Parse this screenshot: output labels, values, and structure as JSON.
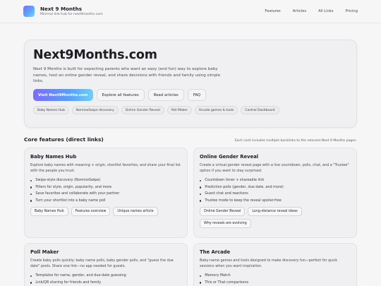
{
  "header": {
    "title": "Next 9 Months",
    "subtitle": "Minimal link hub for next9months.com",
    "nav": [
      "Features",
      "Articles",
      "All Links",
      "Pricing"
    ]
  },
  "hero": {
    "title": "Next9Months.com",
    "description": "Next 9 Months is built for expecting parents who want an easy (and fun) way to explore baby names, host an online gender reveal, and share decisions with friends and family using simple links.",
    "ctas": [
      "Visit Next9Months.com",
      "Explore all features",
      "Read articles",
      "FAQ"
    ],
    "chips": [
      "Baby Names Hub",
      "NominoSwipe discovery",
      "Online Gender Reveal",
      "Poll Maker",
      "Arcade games & tools",
      "Central Dashboard"
    ]
  },
  "section": {
    "title": "Core features (direct links)",
    "note": "Each card includes multiple backlinks to the relevant Next 9 Months pages."
  },
  "cards": [
    {
      "title": "Baby Names Hub",
      "description": "Explore baby names with meaning + origin, shortlist favorites, and share your final list with the people you trust.",
      "bullets": [
        "Swipe-style discovery (NominoSwipe)",
        "Filters for style, origin, popularity, and more",
        "Save favorites and collaborate with your partner",
        "Turn your shortlist into a baby name poll"
      ],
      "links": [
        "Baby Names Hub",
        "Features overview",
        "Unique names article"
      ]
    },
    {
      "title": "Online Gender Reveal",
      "description": "Create a virtual gender reveal page with a live countdown, polls, chat, and a \"Trustee\" option if you want to stay surprised.",
      "bullets": [
        "Countdown timer + shareable link",
        "Prediction polls (gender, due date, and more)",
        "Guest chat and reactions",
        "Trustee mode to keep the reveal spoiler-free"
      ],
      "links": [
        "Online Gender Reveal",
        "Long-distance reveal ideas",
        "Why reveals are evolving"
      ]
    },
    {
      "title": "Poll Maker",
      "description": "Create baby polls quickly: baby name polls, baby gender polls, and \"guess the due date\" pools. Share one link—no app needed for guests.",
      "bullets": [
        "Templates for name, gender, and due-date guessing",
        "Link/QR sharing for friends and family"
      ],
      "links": []
    },
    {
      "title": "The Arcade",
      "description": "Baby-name games and tools designed to make discovery fun—perfect for quick sessions when you want inspiration.",
      "bullets": [
        "Memory Match",
        "This or That comparisons"
      ],
      "links": []
    }
  ]
}
